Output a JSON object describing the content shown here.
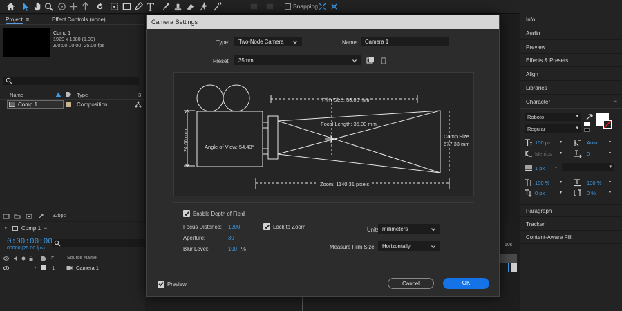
{
  "toolbar": {
    "snapping_label": "Snapping"
  },
  "project": {
    "tab_project": "Project",
    "tab_effect_controls": "Effect Controls (none)",
    "comp_name": "Comp 1",
    "comp_size": "1920 x 1080 (1.00)",
    "comp_duration": "Δ 0:00:10:00, 25.00 fps",
    "col_name": "Name",
    "col_type": "Type",
    "col_count": "3",
    "row_name": "Comp 1",
    "row_type": "Composition",
    "bpc": "32bpc"
  },
  "timeline": {
    "tab": "Comp 1",
    "timecode": "0:00:00:00",
    "fps": "00000 (25.00 fps)",
    "col_source": "Source Name",
    "col_num": "#",
    "layer_index": "1",
    "layer_name": "Camera 1",
    "ruler_end": "10s"
  },
  "right_panel": {
    "items": [
      "Info",
      "Audio",
      "Preview",
      "Effects & Presets",
      "Align",
      "Libraries"
    ],
    "character_title": "Character",
    "font_family": "Roboto",
    "font_style": "Regular",
    "font_size": "100 px",
    "leading": "Auto",
    "kerning": "Metrics",
    "tracking": "0",
    "stroke_width": "1 px",
    "vert_scale": "100 %",
    "horiz_scale": "100 %",
    "baseline_shift": "0 px",
    "tsume": "0 %",
    "bottom_items": [
      "Paragraph",
      "Tracker",
      "Content-Aware Fill"
    ]
  },
  "dialog": {
    "title": "Camera Settings",
    "type_label": "Type:",
    "type_value": "Two-Node Camera",
    "name_label": "Name:",
    "name_value": "Camera 1",
    "preset_label": "Preset:",
    "preset_value": "35mm",
    "diagram": {
      "film_size": "Film Size: 36.00 mm",
      "focal_length": "Focal Length: 35.00 mm",
      "angle_of_view": "Angle of View: 54.43°",
      "film_height": "24.00 mm",
      "comp_size_label": "Comp Size",
      "comp_size_value": "677.33 mm",
      "zoom": "Zoom: 1140.31 pixels"
    },
    "enable_dof": "Enable Depth of Field",
    "focus_distance_label": "Focus Distance:",
    "focus_distance_value": "1200",
    "aperture_label": "Aperture:",
    "aperture_value": "30",
    "blur_level_label": "Blur Level:",
    "blur_level_value": "100",
    "blur_unit": "%",
    "lock_to_zoom": "Lock to Zoom",
    "units_label": "Units:",
    "units_value": "millimeters",
    "measure_label": "Measure Film Size:",
    "measure_value": "Horizontally",
    "preview_label": "Preview",
    "cancel": "Cancel",
    "ok": "OK"
  }
}
